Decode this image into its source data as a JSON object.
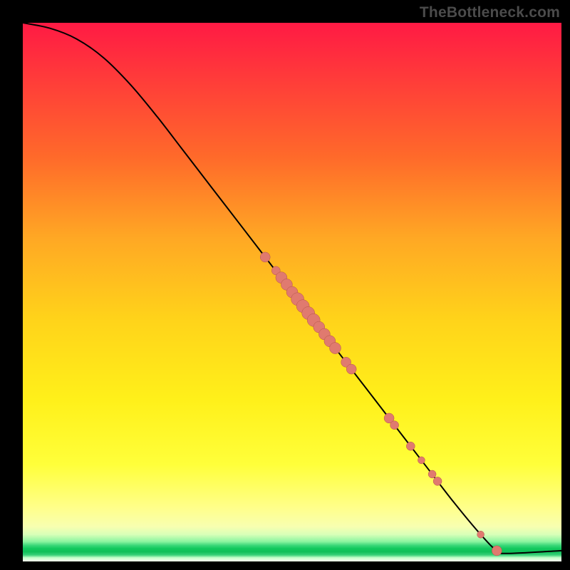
{
  "watermark": "TheBottleneck.com",
  "chart_data": {
    "type": "line",
    "title": "",
    "xlabel": "",
    "ylabel": "",
    "xlim": [
      0,
      100
    ],
    "ylim": [
      0,
      100
    ],
    "grid": false,
    "legend": false,
    "series": [
      {
        "name": "curve",
        "x": [
          0,
          5,
          10,
          15,
          20,
          25,
          30,
          35,
          40,
          45,
          50,
          55,
          60,
          65,
          70,
          75,
          80,
          85,
          88,
          90,
          100
        ],
        "y": [
          100,
          99,
          97,
          93.5,
          88.5,
          82.5,
          76,
          69.5,
          63,
          56.5,
          50,
          43.5,
          37,
          30.5,
          24,
          17.5,
          11,
          5,
          2,
          1.5,
          2
        ]
      }
    ],
    "scatter_on_curve": {
      "name": "highlighted-points",
      "x": [
        45,
        47,
        48,
        49,
        50,
        51,
        52,
        53,
        54,
        55,
        56,
        57,
        58,
        60,
        61,
        68,
        69,
        72,
        74,
        76,
        77,
        85,
        88
      ],
      "y": [
        56.5,
        54,
        52.7,
        51.4,
        50,
        48.7,
        47.4,
        46.1,
        44.8,
        43.5,
        42.2,
        40.9,
        39.6,
        37,
        35.7,
        26.6,
        25.3,
        21.4,
        18.8,
        16.2,
        14.9,
        5,
        2
      ],
      "r": [
        7,
        6,
        8,
        8,
        8,
        9,
        9,
        9,
        9,
        8,
        8,
        8,
        8,
        7,
        7,
        7,
        6,
        6,
        5,
        5.5,
        6,
        5,
        7
      ]
    }
  }
}
